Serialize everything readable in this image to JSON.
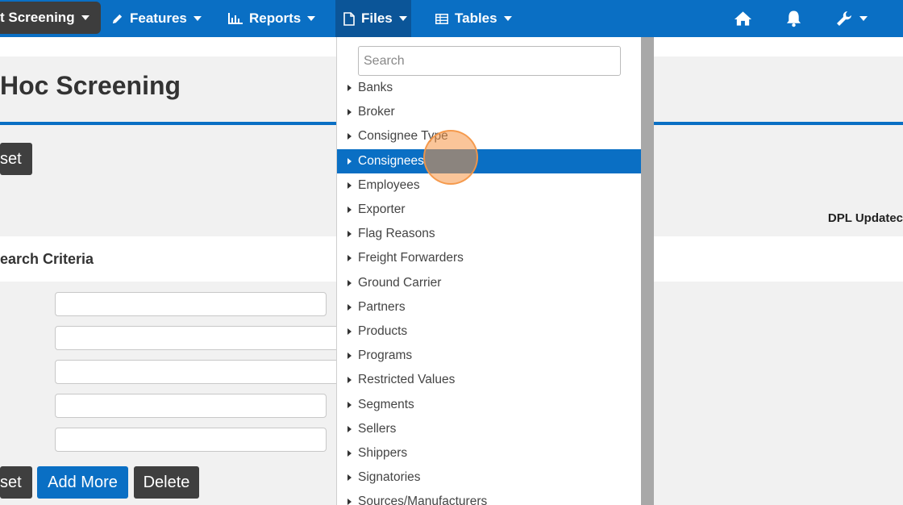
{
  "nav": {
    "screening_label": "t Screening",
    "features_label": "Features",
    "reports_label": "Reports",
    "files_label": "Files",
    "tables_label": "Tables",
    "icons": [
      "home-icon",
      "bell-icon",
      "wrench-icon"
    ]
  },
  "page": {
    "title": "Hoc Screening",
    "reset_label": "set",
    "dpl_label": "DPL Updatec",
    "criteria_title": "earch Criteria",
    "add_more_label": "Add More",
    "delete_label": "Delete",
    "reset2_label": "set"
  },
  "colors": {
    "nav_bg": "#0a6fc4",
    "files_active_bg": "#0b5598",
    "highlight": "#0a6fc4",
    "dark_button": "#3f3f3f"
  },
  "dropdown": {
    "search_placeholder": "Search",
    "active_item": "Consignees",
    "items": [
      "Banks",
      "Broker",
      "Consignee Type",
      "Consignees",
      "Employees",
      "Exporter",
      "Flag Reasons",
      "Freight Forwarders",
      "Ground Carrier",
      "Partners",
      "Products",
      "Programs",
      "Restricted Values",
      "Segments",
      "Sellers",
      "Shippers",
      "Signatories",
      "Sources/Manufacturers"
    ]
  }
}
